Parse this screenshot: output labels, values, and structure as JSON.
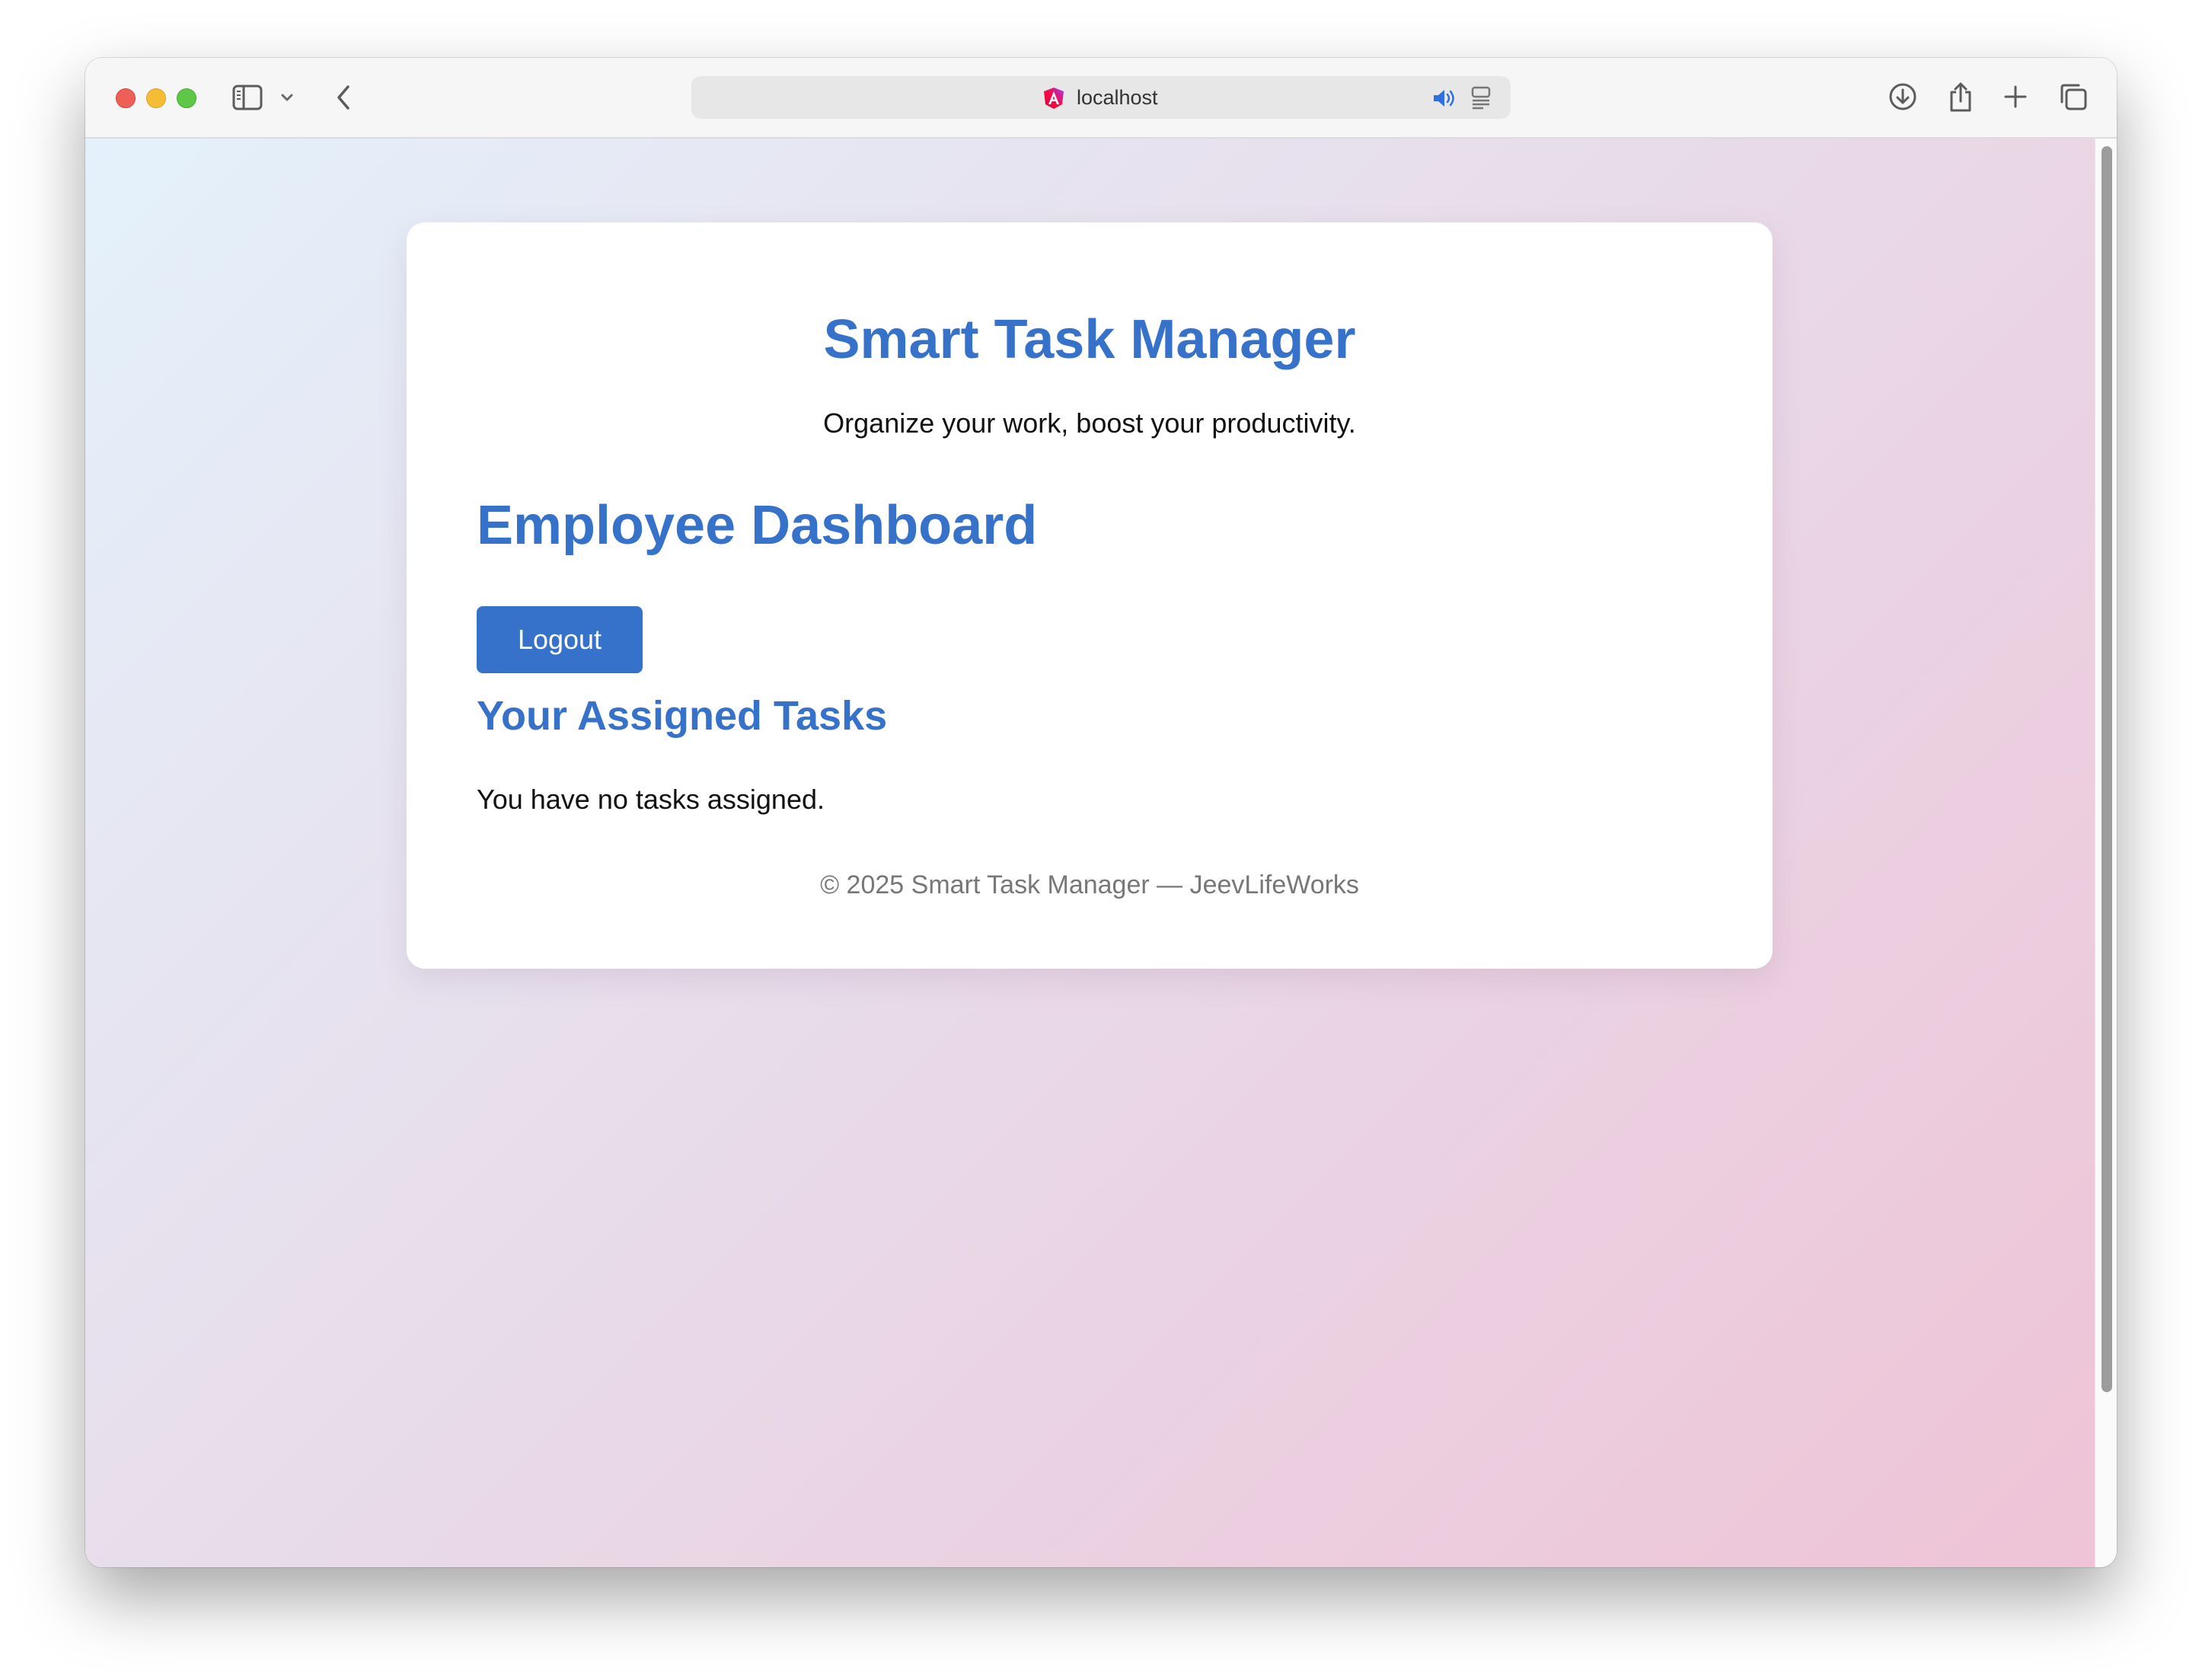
{
  "browser": {
    "address_text": "localhost",
    "icons": {
      "sidebar": "sidebar-icon",
      "tab_menu": "chevron-down-icon",
      "back": "back-arrow-icon",
      "favicon": "angular-logo-icon",
      "audio": "speaker-icon",
      "reader": "reader-icon",
      "download": "download-icon",
      "share": "share-icon",
      "new_tab": "plus-icon",
      "tab_overview": "tabs-icon"
    }
  },
  "app": {
    "title": "Smart Task Manager",
    "tagline": "Organize your work, boost your productivity."
  },
  "dashboard": {
    "title": "Employee Dashboard",
    "logout_label": "Logout",
    "tasks_heading": "Your Assigned Tasks",
    "empty_message": "You have no tasks assigned."
  },
  "footer": {
    "text": "© 2025 Smart Task Manager — JeevLifeWorks"
  },
  "colors": {
    "accent": "#3672c9",
    "gradient_start": "#e4f1fb",
    "gradient_end": "#eec3d6"
  }
}
